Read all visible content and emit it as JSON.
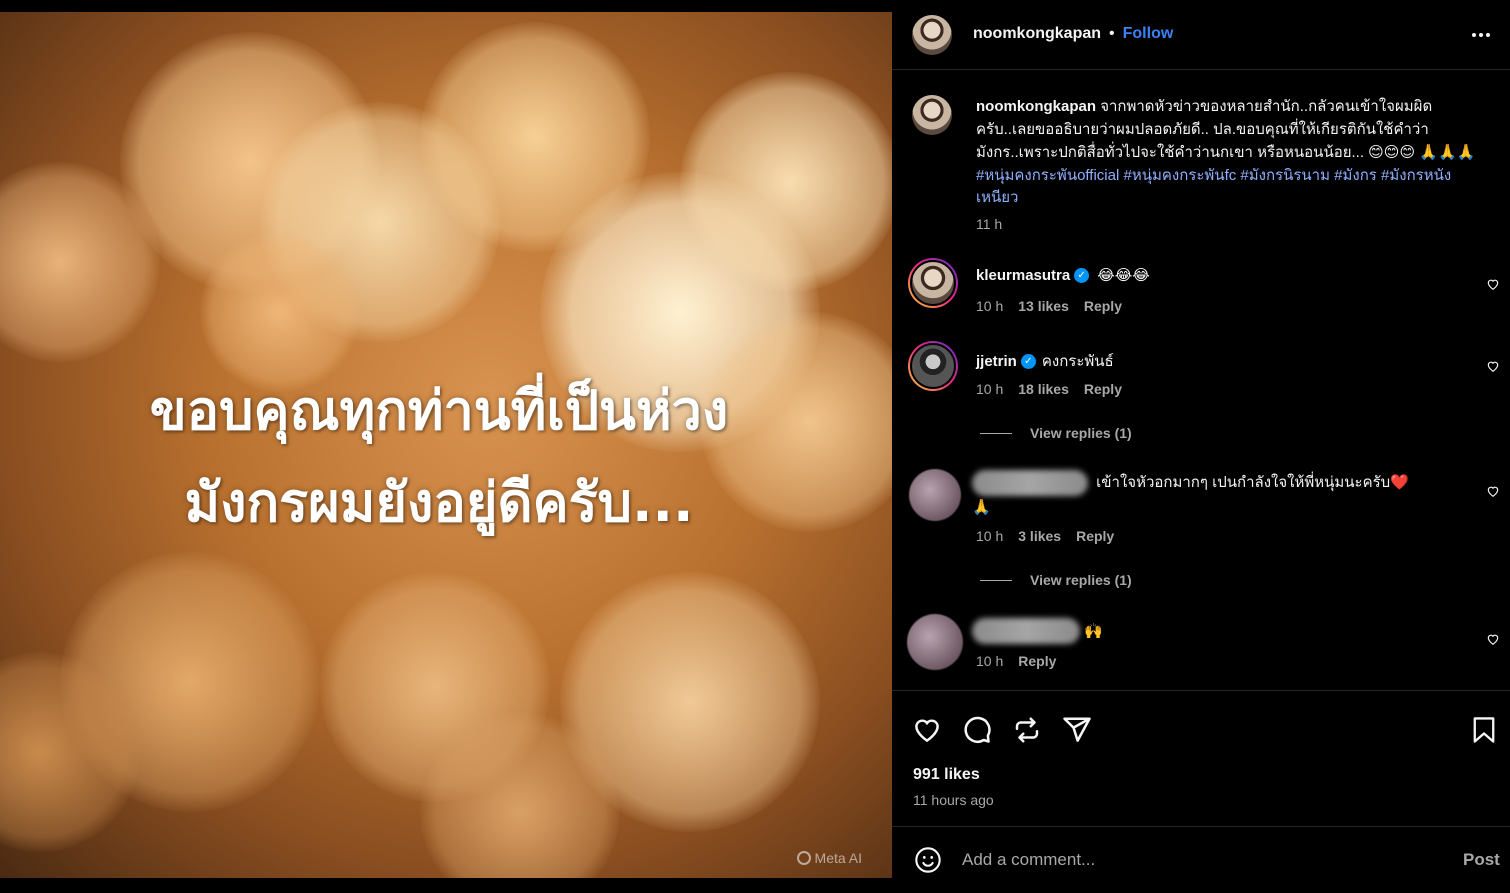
{
  "post": {
    "author": "noomkongkapan",
    "follow_label": "Follow",
    "dot": "•",
    "image_caption_line1": "ขอบคุณทุกท่านที่เป็นห่วง",
    "image_caption_line2": "มังกรผมยังอยู่ดีครับ...",
    "image_watermark": "Meta AI",
    "caption_text": "จากพาดหัวข่าวของหลายสำนัก..กลัวคนเข้าใจผมผิดครับ..เลยขออธิบายว่าผมปลอดภัยดี.. ปล.ขอบคุณที่ให้เกียรติกันใช้คำว่ามังกร..เพราะปกติสื่อทั่วไปจะใช้คำว่านกเขา หรือหนอนน้อย...",
    "caption_emoji": "😊😊😊",
    "caption_prayer": "🙏🙏🙏",
    "hashtags": [
      "#หนุ่มคงกระพันofficial",
      "#หนุ่มคงกระพันfc",
      "#มังกรนิรนาม",
      "#มังกร",
      "#มังกรหนังเหนียว"
    ],
    "caption_time": "11 h",
    "likes": "991 likes",
    "posted_ago": "11 hours ago"
  },
  "comments": [
    {
      "user": "kleurmasutra",
      "verified": true,
      "text": "😂😂😂",
      "time": "10 h",
      "likes": "13 likes",
      "reply": "Reply"
    },
    {
      "user": "jjetrin",
      "verified": true,
      "text": "คงกระพันธ์",
      "time": "10 h",
      "likes": "18 likes",
      "reply": "Reply",
      "view_replies": "View replies (1)"
    },
    {
      "user": "",
      "verified": false,
      "text": "เข้าใจหัวอกมากๆ เปนกำลังใจให้พี่หนุ่มนะครับ",
      "heart_emoji": "❤️",
      "prayer": "🙏",
      "time": "10 h",
      "likes": "3 likes",
      "reply": "Reply",
      "view_replies": "View replies (1)"
    },
    {
      "user": "",
      "verified": false,
      "text": "🙌",
      "time": "10 h",
      "reply": "Reply"
    }
  ],
  "add_comment": {
    "placeholder": "Add a comment...",
    "post_label": "Post"
  },
  "icons": [
    "more-icon",
    "heart-icon",
    "comment-icon",
    "repost-icon",
    "share-icon",
    "bookmark-icon",
    "emoji-icon"
  ],
  "colors": {
    "background": "#000000",
    "follow": "#3b82f6",
    "hashtag": "#8fb0ff",
    "muted": "#a8a8a8"
  }
}
